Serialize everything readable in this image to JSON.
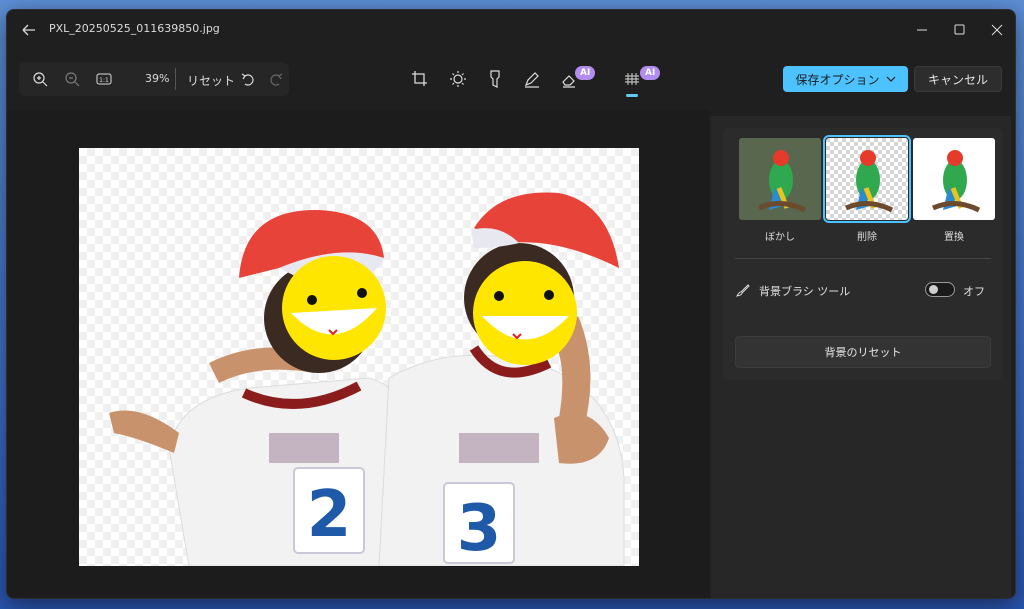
{
  "window": {
    "title": "PXL_20250525_011639850.jpg"
  },
  "toolbar": {
    "zoom_in_icon": "zoom-in-icon",
    "zoom_out_icon": "zoom-out-icon",
    "actual_size_label": "1:1",
    "zoom_percent": "39%",
    "reset_label": "リセット",
    "undo_icon": "undo-icon",
    "redo_icon": "redo-icon",
    "tools": [
      {
        "name": "crop-icon"
      },
      {
        "name": "adjust-brightness-icon"
      },
      {
        "name": "filter-icon"
      },
      {
        "name": "markup-pen-icon"
      },
      {
        "name": "erase-icon",
        "badge": "AI"
      },
      {
        "name": "background-icon",
        "badge": "AI",
        "active": true
      }
    ],
    "save_label": "保存オプション",
    "cancel_label": "キャンセル"
  },
  "panel": {
    "options": [
      {
        "label": "ぼかし",
        "selected": false
      },
      {
        "label": "削除",
        "selected": true
      },
      {
        "label": "置換",
        "selected": false
      }
    ],
    "brush_tool_label": "背景ブラシ ツール",
    "brush_toggle_state": "オフ",
    "reset_background_label": "背景のリセット"
  },
  "colors": {
    "accent": "#4cc2ff",
    "ai_badge": "#b38cf0",
    "window_bg": "#1f1f1f"
  }
}
